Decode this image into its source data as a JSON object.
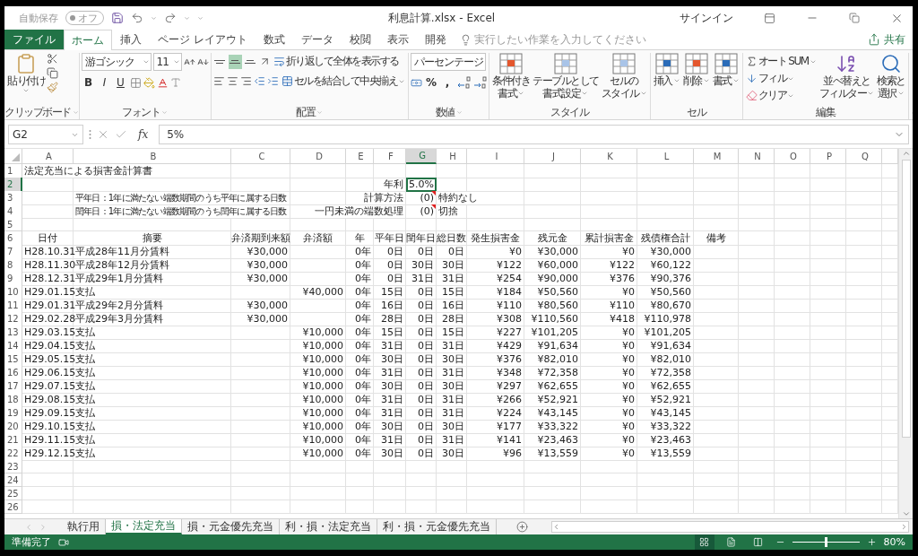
{
  "title_bar": {
    "autosave": {
      "label": "自動保存",
      "state": "オフ",
      "on": false
    },
    "title": "利息計算.xlsx  -  Excel",
    "sign_in": "サインイン"
  },
  "ribbon_tabs": [
    {
      "label": "ファイル",
      "kind": "file",
      "selected": false
    },
    {
      "label": "ホーム",
      "kind": "tab",
      "selected": true
    },
    {
      "label": "挿入",
      "kind": "tab",
      "selected": false
    },
    {
      "label": "ページ レイアウト",
      "kind": "tab",
      "selected": false
    },
    {
      "label": "数式",
      "kind": "tab",
      "selected": false
    },
    {
      "label": "データ",
      "kind": "tab",
      "selected": false
    },
    {
      "label": "校閲",
      "kind": "tab",
      "selected": false
    },
    {
      "label": "表示",
      "kind": "tab",
      "selected": false
    },
    {
      "label": "開発",
      "kind": "tab",
      "selected": false
    }
  ],
  "tell_me": {
    "placeholder": "実行したい作業を入力してください"
  },
  "share": "共有",
  "ribbon": {
    "groups": [
      {
        "kind": "clipboard",
        "label": "クリップボード",
        "paste": "貼り付け"
      },
      {
        "kind": "font",
        "label": "フォント",
        "font_name": "游ゴシック",
        "font_size": "11",
        "styles": [
          "B",
          "I",
          "U"
        ]
      },
      {
        "kind": "alignment",
        "label": "配置",
        "vertical": [
          {
            "selected": false
          },
          {
            "selected": true
          },
          {
            "selected": false
          }
        ],
        "wrap": "折り返して全体を表示する",
        "merge": "セルを結合して中央揃え"
      },
      {
        "kind": "number",
        "label": "数値",
        "format": "パーセンテージ",
        "symbols": [
          "%",
          ","
        ]
      },
      {
        "kind": "styles",
        "label": "スタイル",
        "buttons": [
          [
            "条件付き",
            "書式"
          ],
          [
            "テーブルとして",
            "書式設定"
          ],
          [
            "セルの",
            "スタイル"
          ]
        ]
      },
      {
        "kind": "cells",
        "label": "セル",
        "buttons": [
          [
            "挿入"
          ],
          [
            "削除"
          ],
          [
            "書式"
          ]
        ]
      },
      {
        "kind": "editing",
        "label": "編集",
        "commands": [
          "オート SUM",
          "フィル",
          "クリア"
        ],
        "buttons": [
          [
            "並べ替えと",
            "フィルター"
          ],
          [
            "検索と",
            "選択"
          ]
        ]
      }
    ]
  },
  "formula_bar": {
    "name_box": "G2",
    "function_label": "fx",
    "value": "5%"
  },
  "sheet": {
    "columns": [
      {
        "label": "A",
        "selected": false
      },
      {
        "label": "B",
        "selected": false
      },
      {
        "label": "C",
        "selected": false
      },
      {
        "label": "D",
        "selected": false
      },
      {
        "label": "E",
        "selected": false
      },
      {
        "label": "F",
        "selected": false
      },
      {
        "label": "G",
        "selected": true
      },
      {
        "label": "H",
        "selected": false
      },
      {
        "label": "I",
        "selected": false
      },
      {
        "label": "J",
        "selected": false
      },
      {
        "label": "K",
        "selected": false
      },
      {
        "label": "L",
        "selected": false
      },
      {
        "label": "M",
        "selected": false
      },
      {
        "label": "N",
        "selected": false
      },
      {
        "label": "O",
        "selected": false
      },
      {
        "label": "P",
        "selected": false
      },
      {
        "label": "Q",
        "selected": false
      }
    ],
    "rows": [
      {
        "number": "1",
        "selected": false,
        "kind": "plain",
        "cells": {
          "A": {
            "text": "法定充当による損害金計算書",
            "kind": "text"
          }
        }
      },
      {
        "number": "2",
        "selected": true,
        "kind": "plain",
        "cells": {
          "F": {
            "text": "年利",
            "kind": "label"
          },
          "G": {
            "text": "5.0%",
            "kind": "value",
            "selected": true
          }
        }
      },
      {
        "number": "3",
        "selected": false,
        "kind": "plain",
        "cells": {
          "B": {
            "text": "平年日：1年に満たない端数期間のうち平年に属する日数",
            "kind": "note"
          },
          "F": {
            "text": "計算方法",
            "kind": "label"
          },
          "G": {
            "text": "(0)",
            "kind": "value",
            "comment": true
          },
          "H": {
            "text": "特約なし",
            "kind": "text"
          }
        }
      },
      {
        "number": "4",
        "selected": false,
        "kind": "plain",
        "cells": {
          "B": {
            "text": "閏年日：1年に満たない端数期間のうち閏年に属する日数",
            "kind": "note"
          },
          "F": {
            "text": "一円未満の端数処理",
            "kind": "label"
          },
          "G": {
            "text": "(0)",
            "kind": "value",
            "comment": true
          },
          "H": {
            "text": "切捨",
            "kind": "text"
          }
        }
      },
      {
        "number": "5",
        "selected": false,
        "kind": "plain"
      },
      {
        "number": "6",
        "selected": false,
        "kind": "header",
        "values": {
          "A": "日付",
          "B": "摘要",
          "C": "弁済期到来額",
          "D": "弁済額",
          "E": "年",
          "F": "平年日",
          "G": "閏年日",
          "H": "総日数",
          "I": "発生損害金",
          "J": "残元金",
          "K": "累計損害金",
          "L": "残債権合計",
          "M": "備考"
        }
      },
      {
        "number": "7",
        "selected": false,
        "kind": "data",
        "values": {
          "A": "H28.10.31",
          "B": "平成28年11月分賃料",
          "C": "¥30,000",
          "E": "0年",
          "F": "0日",
          "G": "0日",
          "H": "0日",
          "I": "¥0",
          "J": "¥30,000",
          "K": "¥0",
          "L": "¥30,000"
        }
      },
      {
        "number": "8",
        "selected": false,
        "kind": "data",
        "values": {
          "A": "H28.11.30",
          "B": "平成28年12月分賃料",
          "C": "¥30,000",
          "E": "0年",
          "F": "0日",
          "G": "30日",
          "H": "30日",
          "I": "¥122",
          "J": "¥60,000",
          "K": "¥122",
          "L": "¥60,122"
        }
      },
      {
        "number": "9",
        "selected": false,
        "kind": "data",
        "values": {
          "A": "H28.12.31",
          "B": "平成29年1月分賃料",
          "C": "¥30,000",
          "E": "0年",
          "F": "0日",
          "G": "31日",
          "H": "31日",
          "I": "¥254",
          "J": "¥90,000",
          "K": "¥376",
          "L": "¥90,376"
        }
      },
      {
        "number": "10",
        "selected": false,
        "kind": "data",
        "values": {
          "A": "H29.01.15",
          "B": "支払",
          "D": "¥40,000",
          "E": "0年",
          "F": "15日",
          "G": "0日",
          "H": "15日",
          "I": "¥184",
          "J": "¥50,560",
          "K": "¥0",
          "L": "¥50,560"
        }
      },
      {
        "number": "11",
        "selected": false,
        "kind": "data",
        "values": {
          "A": "H29.01.31",
          "B": "平成29年2月分賃料",
          "C": "¥30,000",
          "E": "0年",
          "F": "16日",
          "G": "0日",
          "H": "16日",
          "I": "¥110",
          "J": "¥80,560",
          "K": "¥110",
          "L": "¥80,670"
        }
      },
      {
        "number": "12",
        "selected": false,
        "kind": "data",
        "values": {
          "A": "H29.02.28",
          "B": "平成29年3月分賃料",
          "C": "¥30,000",
          "E": "0年",
          "F": "28日",
          "G": "0日",
          "H": "28日",
          "I": "¥308",
          "J": "¥110,560",
          "K": "¥418",
          "L": "¥110,978"
        }
      },
      {
        "number": "13",
        "selected": false,
        "kind": "data",
        "values": {
          "A": "H29.03.15",
          "B": "支払",
          "D": "¥10,000",
          "E": "0年",
          "F": "15日",
          "G": "0日",
          "H": "15日",
          "I": "¥227",
          "J": "¥101,205",
          "K": "¥0",
          "L": "¥101,205"
        }
      },
      {
        "number": "14",
        "selected": false,
        "kind": "data",
        "values": {
          "A": "H29.04.15",
          "B": "支払",
          "D": "¥10,000",
          "E": "0年",
          "F": "31日",
          "G": "0日",
          "H": "31日",
          "I": "¥429",
          "J": "¥91,634",
          "K": "¥0",
          "L": "¥91,634"
        }
      },
      {
        "number": "15",
        "selected": false,
        "kind": "data",
        "values": {
          "A": "H29.05.15",
          "B": "支払",
          "D": "¥10,000",
          "E": "0年",
          "F": "30日",
          "G": "0日",
          "H": "30日",
          "I": "¥376",
          "J": "¥82,010",
          "K": "¥0",
          "L": "¥82,010"
        }
      },
      {
        "number": "16",
        "selected": false,
        "kind": "data",
        "values": {
          "A": "H29.06.15",
          "B": "支払",
          "D": "¥10,000",
          "E": "0年",
          "F": "31日",
          "G": "0日",
          "H": "31日",
          "I": "¥348",
          "J": "¥72,358",
          "K": "¥0",
          "L": "¥72,358"
        }
      },
      {
        "number": "17",
        "selected": false,
        "kind": "data",
        "values": {
          "A": "H29.07.15",
          "B": "支払",
          "D": "¥10,000",
          "E": "0年",
          "F": "30日",
          "G": "0日",
          "H": "30日",
          "I": "¥297",
          "J": "¥62,655",
          "K": "¥0",
          "L": "¥62,655"
        }
      },
      {
        "number": "18",
        "selected": false,
        "kind": "data",
        "values": {
          "A": "H29.08.15",
          "B": "支払",
          "D": "¥10,000",
          "E": "0年",
          "F": "31日",
          "G": "0日",
          "H": "31日",
          "I": "¥266",
          "J": "¥52,921",
          "K": "¥0",
          "L": "¥52,921"
        }
      },
      {
        "number": "19",
        "selected": false,
        "kind": "data",
        "values": {
          "A": "H29.09.15",
          "B": "支払",
          "D": "¥10,000",
          "E": "0年",
          "F": "31日",
          "G": "0日",
          "H": "31日",
          "I": "¥224",
          "J": "¥43,145",
          "K": "¥0",
          "L": "¥43,145"
        }
      },
      {
        "number": "20",
        "selected": false,
        "kind": "data",
        "values": {
          "A": "H29.10.15",
          "B": "支払",
          "D": "¥10,000",
          "E": "0年",
          "F": "30日",
          "G": "0日",
          "H": "30日",
          "I": "¥177",
          "J": "¥33,322",
          "K": "¥0",
          "L": "¥33,322"
        }
      },
      {
        "number": "21",
        "selected": false,
        "kind": "data",
        "values": {
          "A": "H29.11.15",
          "B": "支払",
          "D": "¥10,000",
          "E": "0年",
          "F": "31日",
          "G": "0日",
          "H": "31日",
          "I": "¥141",
          "J": "¥23,463",
          "K": "¥0",
          "L": "¥23,463"
        }
      },
      {
        "number": "22",
        "selected": false,
        "kind": "data",
        "values": {
          "A": "H29.12.15",
          "B": "支払",
          "D": "¥10,000",
          "E": "0年",
          "F": "30日",
          "G": "0日",
          "H": "30日",
          "I": "¥96",
          "J": "¥13,559",
          "K": "¥0",
          "L": "¥13,559"
        }
      },
      {
        "number": "23",
        "selected": false,
        "kind": "plain"
      },
      {
        "number": "24",
        "selected": false,
        "kind": "plain"
      },
      {
        "number": "25",
        "selected": false,
        "kind": "plain"
      },
      {
        "number": "26",
        "selected": false,
        "kind": "plain"
      }
    ]
  },
  "sheet_tabs": [
    {
      "label": "執行用",
      "selected": false
    },
    {
      "label": "損・法定充当",
      "selected": true
    },
    {
      "label": "損・元金優先充当",
      "selected": false
    },
    {
      "label": "利・損・法定充当",
      "selected": false
    },
    {
      "label": "利・損・元金優先充当",
      "selected": false
    }
  ],
  "status_bar": {
    "status": "準備完了",
    "views": [
      {
        "selected": true
      },
      {
        "selected": false
      },
      {
        "selected": false
      }
    ],
    "zoom": {
      "level": 0.5,
      "reading": "80%"
    }
  }
}
